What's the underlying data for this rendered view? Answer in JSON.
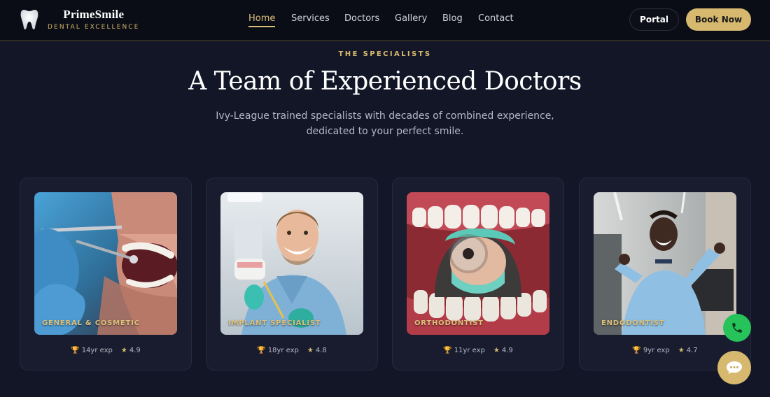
{
  "brand": {
    "name": "PrimeSmile",
    "tagline": "DENTAL EXCELLENCE",
    "logo_icon": "tooth-icon"
  },
  "nav": {
    "items": [
      {
        "label": "Home",
        "active": true
      },
      {
        "label": "Services"
      },
      {
        "label": "Doctors"
      },
      {
        "label": "Gallery"
      },
      {
        "label": "Blog"
      },
      {
        "label": "Contact"
      }
    ],
    "portal_label": "Portal",
    "book_label": "Book Now"
  },
  "section": {
    "eyebrow": "THE SPECIALISTS",
    "title": "A Team of Experienced Doctors",
    "subtitle": "Ivy-League trained specialists with decades of combined experience, dedicated to your perfect smile."
  },
  "doctors": [
    {
      "specialty": "GENERAL & COSMETIC",
      "experience": "14yr exp",
      "rating": "4.9"
    },
    {
      "specialty": "IMPLANT SPECIALIST",
      "experience": "18yr exp",
      "rating": "4.8"
    },
    {
      "specialty": "ORTHODONTIST",
      "experience": "11yr exp",
      "rating": "4.9"
    },
    {
      "specialty": "ENDODONTIST",
      "experience": "9yr exp",
      "rating": "4.7"
    }
  ],
  "icons": {
    "experience": "trophy-icon",
    "rating": "star-icon",
    "phone": "phone-icon",
    "chat": "chat-icon"
  },
  "colors": {
    "background": "#121627",
    "accent_gold": "#d6b86e",
    "card": "#181c2e",
    "phone_green": "#25c35a"
  }
}
